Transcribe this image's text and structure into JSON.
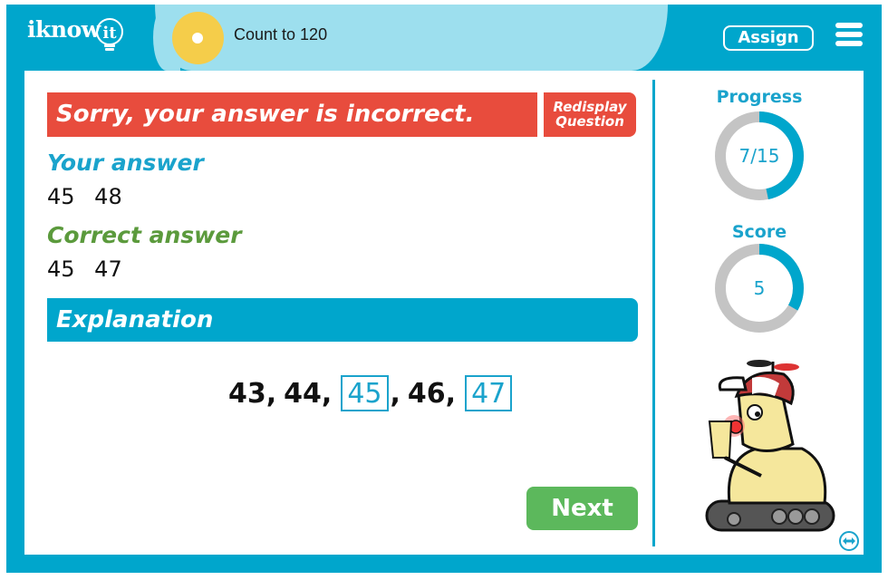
{
  "header": {
    "logo_text": "iknow",
    "logo_tail": "it",
    "lesson_title": "Count to 120",
    "assign_label": "Assign",
    "menu_icon": "hamburger-menu-icon"
  },
  "feedback": {
    "banner": "Sorry, your answer is incorrect.",
    "redisplay_line1": "Redisplay",
    "redisplay_line2": "Question",
    "your_answer_label": "Your answer",
    "your_answer_values": [
      "45",
      "48"
    ],
    "your_answer_text": "45 48",
    "correct_answer_label": "Correct answer",
    "correct_answer_values": [
      "45",
      "47"
    ],
    "correct_answer_text": "45 47"
  },
  "explanation": {
    "title": "Explanation",
    "sequence": [
      {
        "value": "43",
        "highlight": false,
        "sep": ", "
      },
      {
        "value": "44",
        "highlight": false,
        "sep": ", "
      },
      {
        "value": "45",
        "highlight": true,
        "sep": ", "
      },
      {
        "value": "46",
        "highlight": false,
        "sep": ", "
      },
      {
        "value": "47",
        "highlight": true,
        "sep": ""
      }
    ]
  },
  "next_label": "Next",
  "sidebar": {
    "progress_label": "Progress",
    "progress_text": "7/15",
    "progress_fraction": 0.4667,
    "score_label": "Score",
    "score_text": "5",
    "score_fraction": 0.3333
  },
  "colors": {
    "brand_teal": "#00a6cc",
    "light_teal": "#9ddfee",
    "incorrect_red": "#e84c3d",
    "correct_green": "#5b9a3c",
    "next_green": "#5cb85c",
    "ring_gray": "#c4c4c4",
    "lesson_yellow": "#f5cd4a"
  }
}
